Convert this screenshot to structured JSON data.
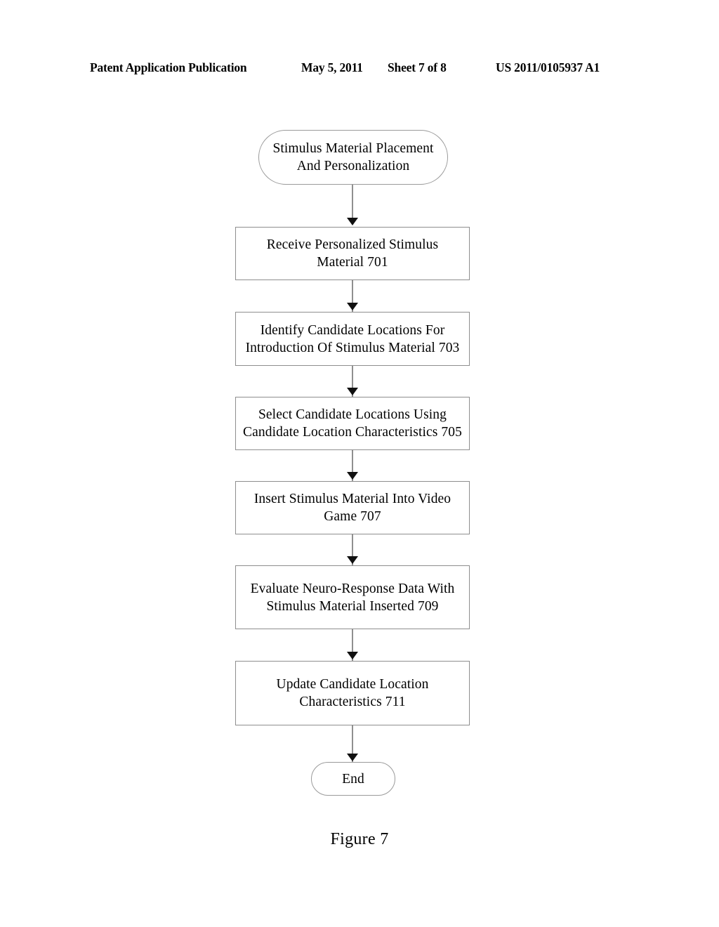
{
  "header": {
    "publication": "Patent Application Publication",
    "date": "May 5, 2011",
    "sheet": "Sheet 7 of 8",
    "document_number": "US 2011/0105937 A1"
  },
  "figure": {
    "caption": "Figure 7",
    "type": "flowchart"
  },
  "flowchart": {
    "nodes": [
      {
        "id": "start",
        "shape": "terminal",
        "label": "Stimulus Material Placement And Personalization",
        "line1": "Stimulus Material Placement",
        "line2": "And Personalization"
      },
      {
        "id": "step-701",
        "shape": "process",
        "reference": "701",
        "label": "Receive Personalized Stimulus Material 701",
        "line1": "Receive Personalized Stimulus",
        "line2": "Material 701"
      },
      {
        "id": "step-703",
        "shape": "process",
        "reference": "703",
        "label": "Identify Candidate Locations For Introduction Of Stimulus Material 703",
        "line1": "Identify Candidate Locations For",
        "line2": "Introduction Of Stimulus Material 703"
      },
      {
        "id": "step-705",
        "shape": "process",
        "reference": "705",
        "label": "Select Candidate Locations Using Candidate Location Characteristics 705",
        "line1": "Select Candidate Locations Using",
        "line2": "Candidate Location Characteristics 705"
      },
      {
        "id": "step-707",
        "shape": "process",
        "reference": "707",
        "label": "Insert Stimulus Material Into Video Game 707",
        "line1": "Insert Stimulus Material Into Video",
        "line2": "Game 707"
      },
      {
        "id": "step-709",
        "shape": "process",
        "reference": "709",
        "label": "Evaluate Neuro-Response Data With Stimulus Material Inserted 709",
        "line1": "Evaluate Neuro-Response Data With",
        "line2": "Stimulus Material Inserted 709"
      },
      {
        "id": "step-711",
        "shape": "process",
        "reference": "711",
        "label": "Update Candidate Location Characteristics 711",
        "line1": "Update Candidate Location",
        "line2": "Characteristics 711"
      },
      {
        "id": "end",
        "shape": "terminal",
        "label": "End",
        "line1": "End",
        "line2": ""
      }
    ],
    "edges": [
      {
        "from": "start",
        "to": "step-701"
      },
      {
        "from": "step-701",
        "to": "step-703"
      },
      {
        "from": "step-703",
        "to": "step-705"
      },
      {
        "from": "step-705",
        "to": "step-707"
      },
      {
        "from": "step-707",
        "to": "step-709"
      },
      {
        "from": "step-709",
        "to": "step-711"
      },
      {
        "from": "step-711",
        "to": "end"
      }
    ],
    "colors": {
      "background": "#ffffff",
      "box_border": "#8e8e8e",
      "connector": "#8f8f8f",
      "arrowhead": "#101010",
      "text": "#000000"
    }
  }
}
